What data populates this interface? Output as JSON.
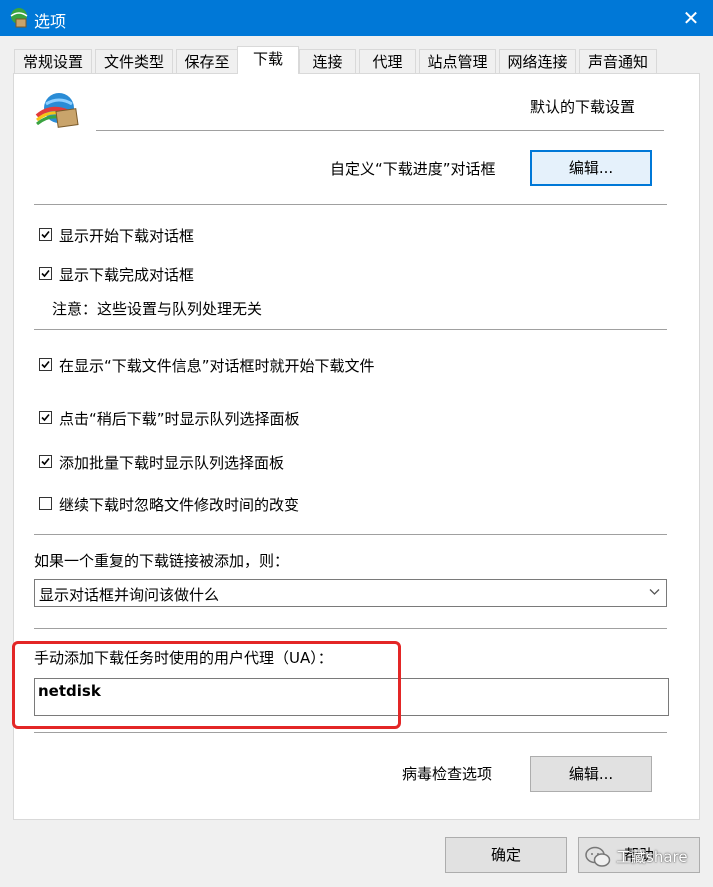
{
  "window": {
    "title": "选项",
    "close_glyph": "✕"
  },
  "tabs": [
    {
      "label": "常规设置"
    },
    {
      "label": "文件类型"
    },
    {
      "label": "保存至"
    },
    {
      "label": "下载",
      "active": true
    },
    {
      "label": "连接"
    },
    {
      "label": "代理"
    },
    {
      "label": "站点管理"
    },
    {
      "label": "网络连接"
    },
    {
      "label": "声音通知"
    }
  ],
  "defaults": {
    "icon": "idm-globe-icon",
    "header": "默认的下载设置",
    "progress_dialog_label": "自定义“下载进度”对话框",
    "edit_button": "编辑..."
  },
  "dialog_options": [
    {
      "label": "显示开始下载对话框",
      "checked": true
    },
    {
      "label": "显示下载完成对话框",
      "checked": true
    }
  ],
  "note": "注意：这些设置与队列处理无关",
  "behavior_options": [
    {
      "label": "在显示“下载文件信息”对话框时就开始下载文件",
      "checked": true
    },
    {
      "label": "点击“稍后下载”时显示队列选择面板",
      "checked": true
    },
    {
      "label": "添加批量下载时显示队列选择面板",
      "checked": true
    },
    {
      "label": "继续下载时忽略文件修改时间的改变",
      "checked": false
    }
  ],
  "duplicate": {
    "label": "如果一个重复的下载链接被添加，则：",
    "selected": "显示对话框并询问该做什么"
  },
  "user_agent": {
    "label": "手动添加下载任务时使用的用户代理（UA）：",
    "value": "netdisk"
  },
  "virus": {
    "label": "病毒检查选项",
    "button": "编辑..."
  },
  "footer": {
    "ok": "确定",
    "help": "帮助"
  },
  "watermark": {
    "text": "工藏share"
  },
  "colors": {
    "titlebar": "#0078d7",
    "highlight": "#e32626",
    "accent_border": "#0078d7"
  }
}
